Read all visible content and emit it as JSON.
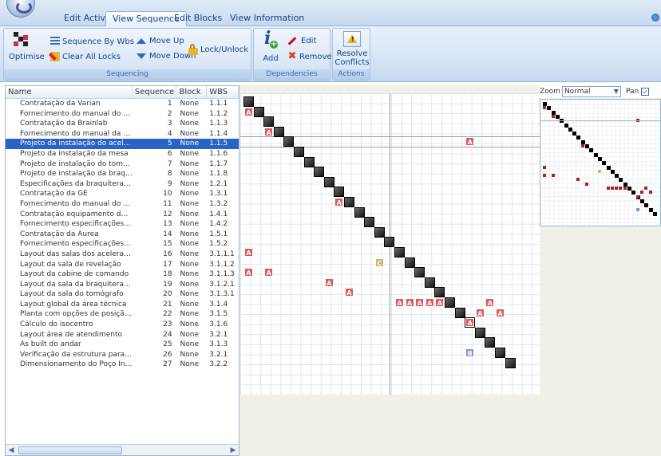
{
  "tabs": [
    {
      "label": "Edit Activities",
      "active": false
    },
    {
      "label": "View Sequence",
      "active": true
    },
    {
      "label": "Edit Blocks",
      "active": false
    },
    {
      "label": "View Information",
      "active": false
    }
  ],
  "ribbon": {
    "sequencing": {
      "optimise": "Optimise",
      "sequence_by_wbs": "Sequence By Wbs",
      "clear_all_locks": "Clear All Locks",
      "move_up": "Move Up",
      "move_down": "Move Down",
      "lock_unlock": "Lock/Unlock",
      "label": "Sequencing"
    },
    "dependencies": {
      "add": "Add",
      "edit": "Edit",
      "remove": "Remove",
      "label": "Dependencies"
    },
    "actions": {
      "resolve_line1": "Resolve",
      "resolve_line2": "Conflicts",
      "label": "Actions"
    }
  },
  "grid": {
    "columns": {
      "name": "Name",
      "sequence": "Sequence",
      "block": "Block",
      "wbs": "WBS"
    },
    "rows": [
      {
        "name": "Contratação da Varian",
        "seq": "1",
        "block": "None",
        "wbs": "1.1.1"
      },
      {
        "name": "Fornecimento do manual do acele...",
        "seq": "2",
        "block": "None",
        "wbs": "1.1.2"
      },
      {
        "name": "Contratação da Brainlab",
        "seq": "3",
        "block": "None",
        "wbs": "1.1.3"
      },
      {
        "name": "Fornecimento do manual da mesa...",
        "seq": "4",
        "block": "None",
        "wbs": "1.1.4"
      },
      {
        "name": "Projeto da instalação do acelerador",
        "seq": "5",
        "block": "None",
        "wbs": "1.1.5",
        "selected": true
      },
      {
        "name": "Projeto da instalação da mesa",
        "seq": "6",
        "block": "None",
        "wbs": "1.1.6"
      },
      {
        "name": "Projeto de instalação do tomógrafo",
        "seq": "7",
        "block": "None",
        "wbs": "1.1.7"
      },
      {
        "name": "Projeto de instalação da braquiter...",
        "seq": "8",
        "block": "None",
        "wbs": "1.1.8"
      },
      {
        "name": "Especificações da braquiterapia",
        "seq": "9",
        "block": "None",
        "wbs": "1.2.1"
      },
      {
        "name": "Contratação da GE",
        "seq": "10",
        "block": "None",
        "wbs": "1.3.1"
      },
      {
        "name": "Fornecimento do manual do tomó...",
        "seq": "11",
        "block": "None",
        "wbs": "1.3.2"
      },
      {
        "name": "Contratação equipamento de rev...",
        "seq": "12",
        "block": "None",
        "wbs": "1.4.1"
      },
      {
        "name": "Fornecimento especificações do ...",
        "seq": "13",
        "block": "None",
        "wbs": "1.4.2"
      },
      {
        "name": "Contratação da Aurea",
        "seq": "14",
        "block": "None",
        "wbs": "1.5.1"
      },
      {
        "name": "Fornecimento especificações da ...",
        "seq": "15",
        "block": "None",
        "wbs": "1.5.2"
      },
      {
        "name": "Layout das salas dos aceleradores",
        "seq": "16",
        "block": "None",
        "wbs": "3.1.1.1"
      },
      {
        "name": "Layout da sala de revelação",
        "seq": "17",
        "block": "None",
        "wbs": "3.1.1.2"
      },
      {
        "name": "Layout da cabine de comando",
        "seq": "18",
        "block": "None",
        "wbs": "3.1.1.3"
      },
      {
        "name": "Layout da sala da braquiterapia",
        "seq": "19",
        "block": "None",
        "wbs": "3.1.2.1"
      },
      {
        "name": "Layout da sala do tomógrafo",
        "seq": "20",
        "block": "None",
        "wbs": "3.1.3.1"
      },
      {
        "name": "Layout global da área técnica",
        "seq": "21",
        "block": "None",
        "wbs": "3.1.4"
      },
      {
        "name": "Planta com opções de posição d...",
        "seq": "22",
        "block": "None",
        "wbs": "3.1.5"
      },
      {
        "name": "Cálculo do isocentro",
        "seq": "23",
        "block": "None",
        "wbs": "3.1.6"
      },
      {
        "name": "Layout área de atendimento",
        "seq": "24",
        "block": "None",
        "wbs": "3.2.1"
      },
      {
        "name": "As built do andar",
        "seq": "25",
        "block": "None",
        "wbs": "3.1.3"
      },
      {
        "name": "Verificação da estrutura para o pe...",
        "seq": "26",
        "block": "None",
        "wbs": "3.2.1"
      },
      {
        "name": "Dimensionamento do Poço Inglês",
        "seq": "27",
        "block": "None",
        "wbs": "3.2.2"
      }
    ]
  },
  "dsm": {
    "size": 27,
    "selected_row": 5,
    "selected_col": 15,
    "marks": [
      {
        "r": 2,
        "c": 1,
        "t": "A"
      },
      {
        "r": 4,
        "c": 3,
        "t": "A"
      },
      {
        "r": 5,
        "c": 23,
        "t": "A"
      },
      {
        "r": 11,
        "c": 10,
        "t": "A"
      },
      {
        "r": 16,
        "c": 1,
        "t": "A"
      },
      {
        "r": 17,
        "c": 14,
        "t": "C"
      },
      {
        "r": 18,
        "c": 1,
        "t": "A"
      },
      {
        "r": 18,
        "c": 3,
        "t": "A"
      },
      {
        "r": 19,
        "c": 9,
        "t": "A"
      },
      {
        "r": 20,
        "c": 11,
        "t": "A"
      },
      {
        "r": 21,
        "c": 16,
        "t": "A"
      },
      {
        "r": 21,
        "c": 17,
        "t": "A"
      },
      {
        "r": 21,
        "c": 18,
        "t": "A"
      },
      {
        "r": 21,
        "c": 19,
        "t": "A"
      },
      {
        "r": 21,
        "c": 20,
        "t": "A"
      },
      {
        "r": 21,
        "c": 25,
        "t": "A"
      },
      {
        "r": 22,
        "c": 24,
        "t": "A"
      },
      {
        "r": 22,
        "c": 26,
        "t": "A"
      },
      {
        "r": 23,
        "c": 23,
        "t": "A"
      },
      {
        "r": 26,
        "c": 23,
        "t": "B"
      }
    ]
  },
  "overview": {
    "zoom_label": "Zoom",
    "zoom_value": "Normal",
    "pan_label": "Pan",
    "pan_checked": true
  },
  "colors": {
    "dep_A": "#e05858",
    "dep_C": "#d1b36b",
    "dep_B": "#7c95dd",
    "selection": "#2a62c8"
  }
}
